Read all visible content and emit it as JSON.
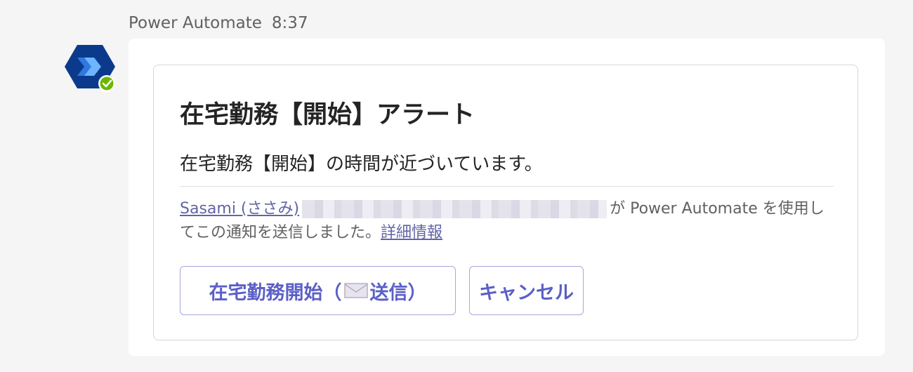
{
  "message": {
    "sender": "Power Automate",
    "time": "8:37"
  },
  "card": {
    "title": "在宅勤務【開始】アラート",
    "body": "在宅勤務【開始】の時間が近づいています。",
    "attribution": {
      "user_link": "Sasami (ささみ)",
      "text_after": "が Power Automate を使用し",
      "line2": "てこの通知を送信しました。",
      "details_link": "詳細情報"
    }
  },
  "actions": {
    "start_prefix": "在宅勤務開始（",
    "start_suffix": "送信）",
    "cancel": "キャンセル"
  },
  "colors": {
    "accent": "#5b5fc7",
    "link": "#6264a7",
    "avatar_bg": "#0b3a8c",
    "status_badge": "#6bb700"
  },
  "icons": {
    "avatar": "power-automate-logo",
    "status": "available-check-icon",
    "button": "mail-envelope-icon"
  }
}
